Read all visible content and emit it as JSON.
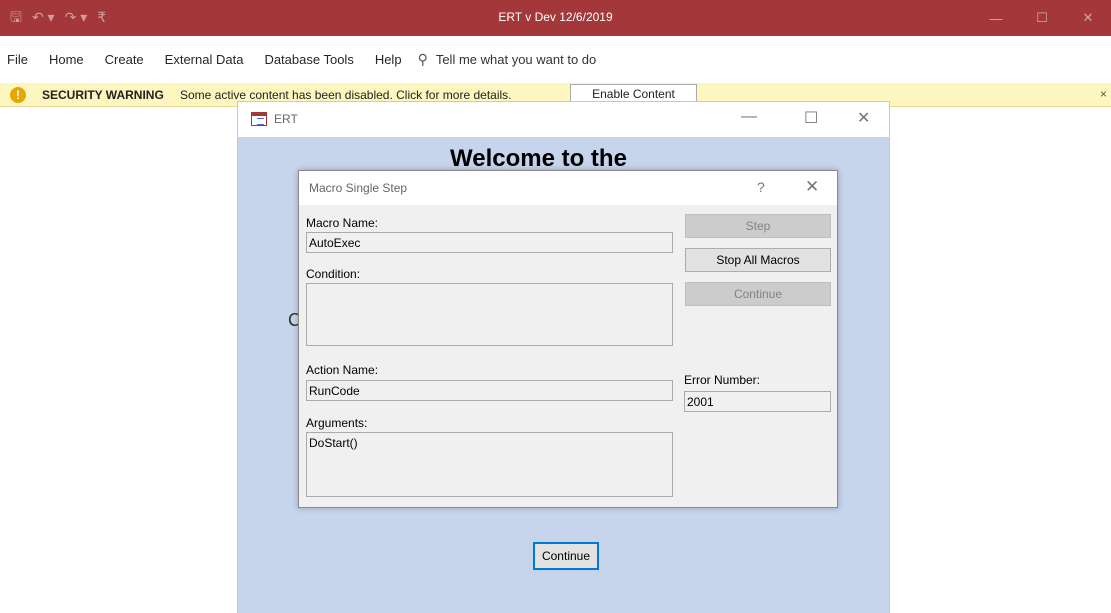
{
  "titlebar": {
    "title": "ERT v Dev 12/6/2019",
    "qat": {
      "save_glyph": "🖫",
      "undo_glyph": "↶ ▾",
      "redo_glyph": "↷ ▾",
      "customize_glyph": "₹"
    },
    "controls": {
      "minimize": "—",
      "maximize": "☐",
      "close": "✕"
    }
  },
  "menu": {
    "items": [
      "File",
      "Home",
      "Create",
      "External Data",
      "Database Tools",
      "Help"
    ],
    "tell_me": "Tell me what you want to do",
    "tell_me_icon": "⚲"
  },
  "security_bar": {
    "icon": "!",
    "label": "SECURITY WARNING",
    "message": "Some active content has been disabled. Click for more details.",
    "button": "Enable Content",
    "close": "×"
  },
  "ert_form": {
    "title": "ERT",
    "welcome": "Welcome to the",
    "stray_char": "C",
    "continue_button": "Continue",
    "controls": {
      "minimize": "—",
      "maximize": "☐",
      "close": "✕"
    }
  },
  "dialog": {
    "title": "Macro Single Step",
    "help": "?",
    "close": "✕",
    "macro_name_label": "Macro Name:",
    "macro_name_value": "AutoExec",
    "condition_label": "Condition:",
    "condition_value": "",
    "action_name_label": "Action Name:",
    "action_name_value": "RunCode",
    "arguments_label": "Arguments:",
    "arguments_value": "DoStart()",
    "error_number_label": "Error Number:",
    "error_number_value": "2001",
    "buttons": {
      "step": "Step",
      "stop_all": "Stop All Macros",
      "continue": "Continue"
    }
  },
  "colors": {
    "accent": "#a4373a",
    "form_background": "#c6d4ec",
    "security_bar": "#fdf6bf"
  }
}
